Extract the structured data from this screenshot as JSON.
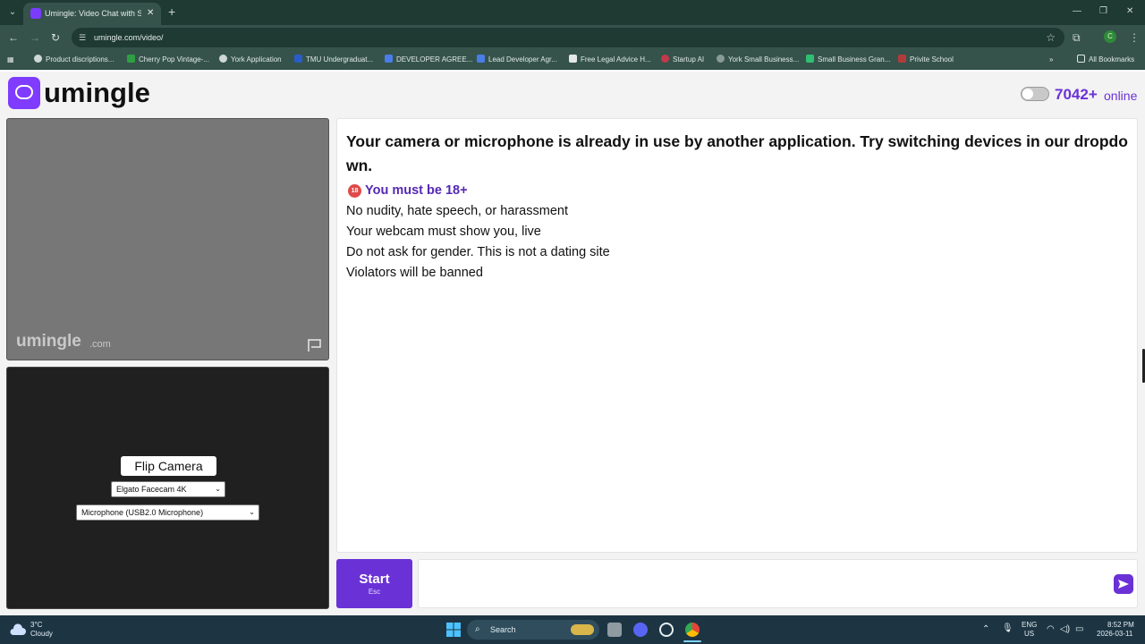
{
  "browser": {
    "tab_title": "Umingle: Video Chat with Strangers",
    "tab_close": "✕",
    "new_tab": "+",
    "url": "umingle.com/video/",
    "bookmarks": [
      "Product discriptions...",
      "Cherry Pop Vintage-...",
      "York Application",
      "TMU Undergraduat...",
      "DEVELOPER AGREE...",
      "Lead Developer Agr...",
      "Free Legal Advice H...",
      "Startup AI",
      "York Small Business...",
      "Small Business Gran...",
      "Privite School"
    ],
    "all_bookmarks": "All Bookmarks",
    "profile_initial": "C"
  },
  "site": {
    "logo_text": "umingle",
    "online_count": "7042+",
    "online_word": "online",
    "accent_color": "#6a32d6"
  },
  "video": {
    "watermark": "umingle",
    "watermark_domain": ".com",
    "flip_camera": "Flip Camera",
    "camera_select": "Elgato Facecam 4K",
    "mic_select": "Microphone (USB2.0 Microphone)"
  },
  "chat": {
    "error_message": "Your camera or microphone is already in use by another application. Try switching devices in our dropdown.",
    "age_badge": "18",
    "age_notice": "You must be 18+",
    "rules": [
      "No nudity, hate speech, or harassment",
      "Your webcam must show you, live",
      "Do not ask for gender. This is not a dating site",
      "Violators will be banned"
    ],
    "start_label": "Start",
    "start_key": "Esc",
    "message_placeholder": ""
  },
  "taskbar": {
    "temperature": "3°C",
    "weather": "Cloudy",
    "search_label": "Search",
    "lang": "ENG",
    "region": "US",
    "time": "8:52 PM",
    "date": "2026-03-11"
  }
}
